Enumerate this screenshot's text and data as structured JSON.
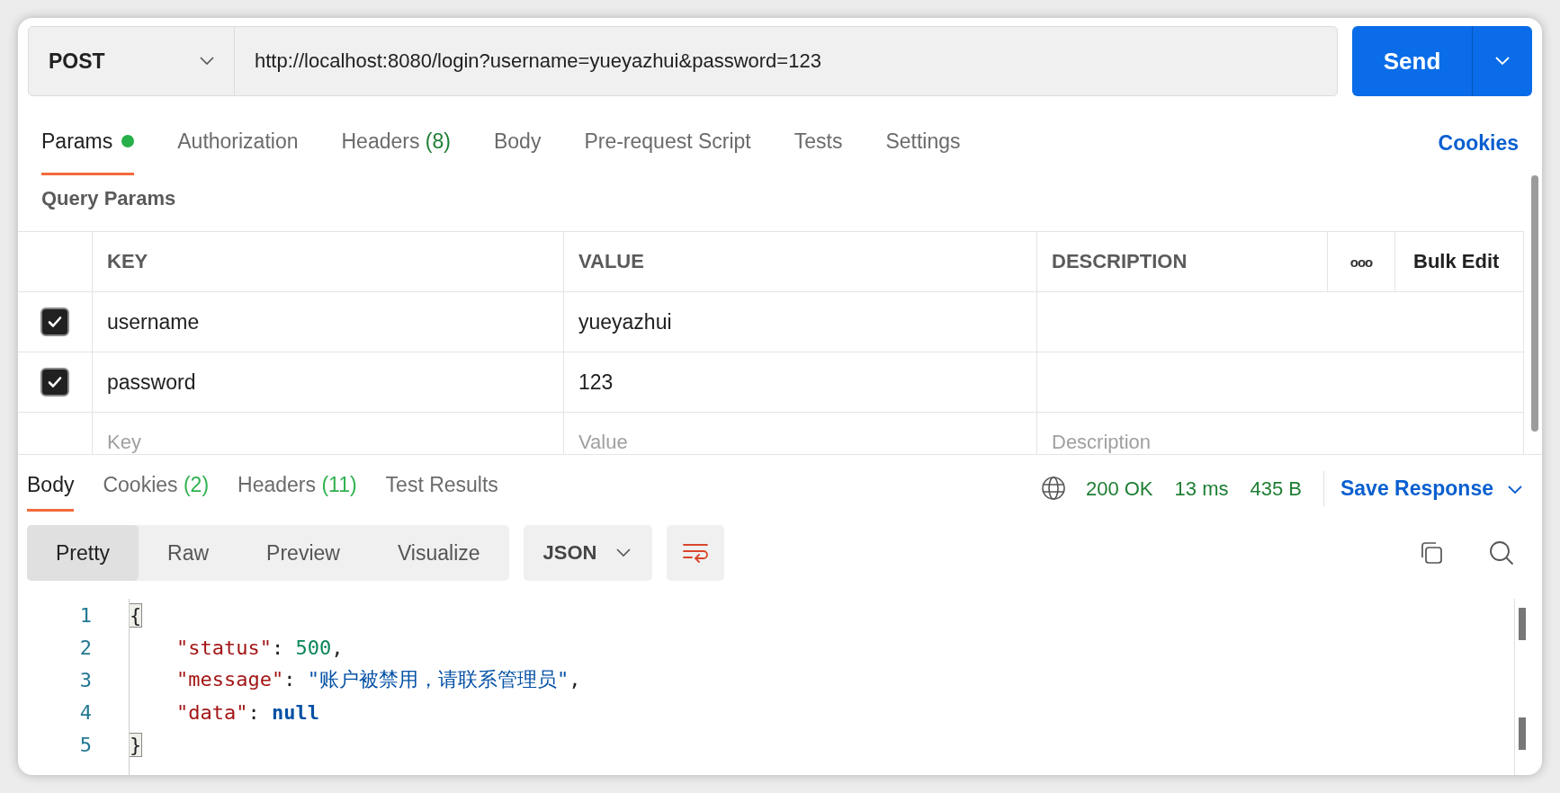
{
  "request": {
    "method": "POST",
    "url": "http://localhost:8080/login?username=yueyazhui&password=123",
    "send_label": "Send"
  },
  "request_tabs": [
    {
      "label": "Params",
      "dot": true,
      "selected": true
    },
    {
      "label": "Authorization",
      "dot": false,
      "selected": false
    },
    {
      "label": "Headers",
      "count": "(8)",
      "dot": false,
      "selected": false
    },
    {
      "label": "Body",
      "dot": false,
      "selected": false
    },
    {
      "label": "Pre-request Script",
      "dot": false,
      "selected": false
    },
    {
      "label": "Tests",
      "dot": false,
      "selected": false
    },
    {
      "label": "Settings",
      "dot": false,
      "selected": false
    }
  ],
  "cookies_link": "Cookies",
  "query_params": {
    "title": "Query Params",
    "columns": [
      "KEY",
      "VALUE",
      "DESCRIPTION"
    ],
    "more_label": "ooo",
    "bulk_edit": "Bulk Edit",
    "rows": [
      {
        "checked": true,
        "key": "username",
        "value": "yueyazhui"
      },
      {
        "checked": true,
        "key": "password",
        "value": "123"
      }
    ],
    "new_row": {
      "key": {
        "placeholder": "Key"
      },
      "value": {
        "placeholder": "Value"
      },
      "description": {
        "placeholder": "Description"
      }
    }
  },
  "response_tabs": [
    {
      "label": "Body",
      "selected": true
    },
    {
      "label": "Cookies",
      "count": "(2)",
      "selected": false
    },
    {
      "label": "Headers",
      "count": "(11)",
      "selected": false
    },
    {
      "label": "Test Results",
      "selected": false
    }
  ],
  "response_status": {
    "status": "200 OK",
    "time": "13 ms",
    "size": "435 B",
    "save_label": "Save Response"
  },
  "view_modes": [
    {
      "label": "Pretty",
      "selected": true
    },
    {
      "label": "Raw",
      "selected": false
    },
    {
      "label": "Preview",
      "selected": false
    },
    {
      "label": "Visualize",
      "selected": false
    }
  ],
  "format": "JSON",
  "code_lines": [
    {
      "number": "1",
      "tokens": [
        {
          "kind": "bracket",
          "text": "{"
        }
      ]
    },
    {
      "number": "2",
      "tokens": [
        {
          "kind": "key",
          "text": "\"status\""
        },
        {
          "kind": "punct",
          "text": ": "
        },
        {
          "kind": "number",
          "text": "500"
        },
        {
          "kind": "punct",
          "text": ","
        }
      ]
    },
    {
      "number": "3",
      "tokens": [
        {
          "kind": "key",
          "text": "\"message\""
        },
        {
          "kind": "punct",
          "text": ": "
        },
        {
          "kind": "string",
          "text": "\"账户被禁用，请联系管理员\""
        },
        {
          "kind": "punct",
          "text": ","
        }
      ]
    },
    {
      "number": "4",
      "tokens": [
        {
          "kind": "key",
          "text": "\"data\""
        },
        {
          "kind": "punct",
          "text": ": "
        },
        {
          "kind": "null",
          "text": "null"
        }
      ]
    },
    {
      "number": "5",
      "tokens": [
        {
          "kind": "bracket",
          "text": "}"
        }
      ]
    }
  ]
}
